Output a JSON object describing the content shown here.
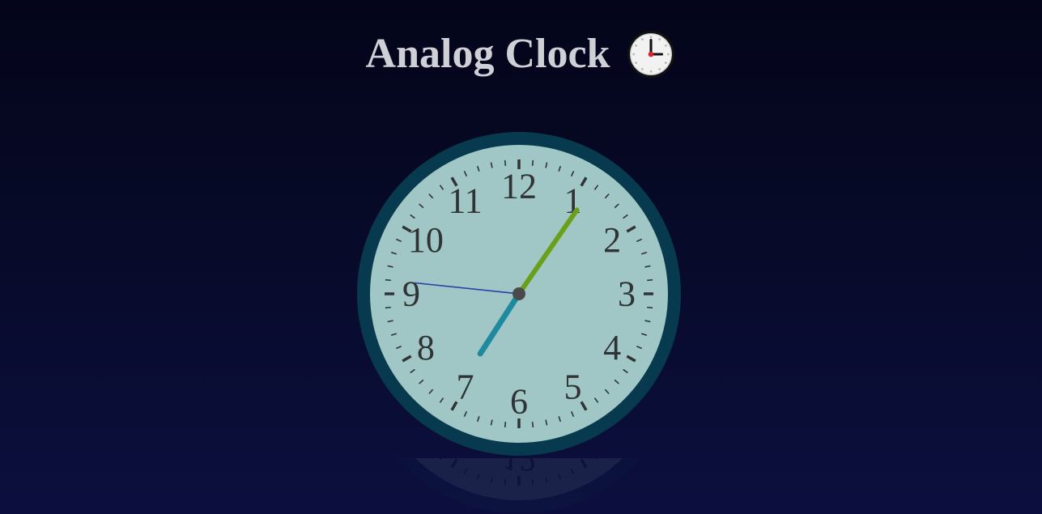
{
  "header": {
    "title": "Analog Clock",
    "icon": "three-oclock-icon"
  },
  "clock": {
    "numerals": [
      "12",
      "1",
      "2",
      "3",
      "4",
      "5",
      "6",
      "7",
      "8",
      "9",
      "10",
      "11"
    ],
    "time": {
      "hours": 7,
      "minutes": 5,
      "seconds": 46
    },
    "colors": {
      "rim": "#073a4e",
      "face": "#a0c6c6",
      "numerals": "#2f3333",
      "ticks": "#2f3333",
      "hour_hand": "#1d8aa0",
      "minute_hand": "#6aa019",
      "second_hand": "#2a3ea6",
      "center": "#4a4a4a"
    }
  }
}
